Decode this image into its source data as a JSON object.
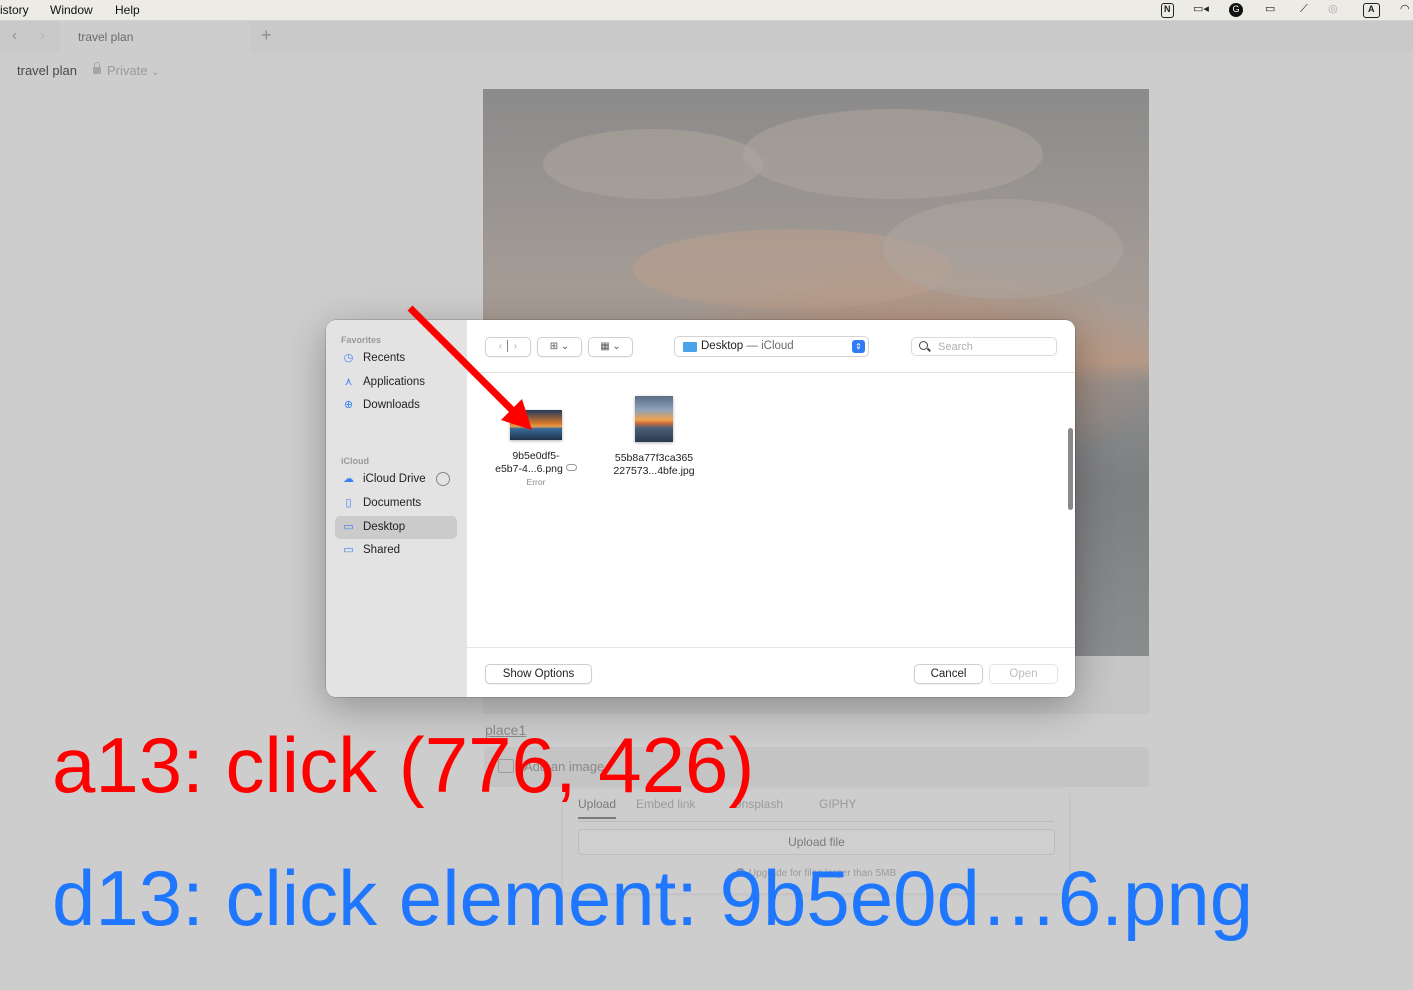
{
  "menubar": {
    "items": [
      "istory",
      "Window",
      "Help"
    ],
    "tray_icons": [
      "notion-icon",
      "zoom-icon",
      "grammarly-icon",
      "display-icon",
      "mic-mute-icon",
      "airdrop-icon",
      "input-source-icon",
      "wifi-icon"
    ],
    "tray_labels": {
      "notion": "N",
      "input_source": "A"
    }
  },
  "browser": {
    "tab_title": "travel plan",
    "new_tab": "+",
    "back": "‹",
    "forward": "›"
  },
  "page": {
    "breadcrumb_title": "travel plan",
    "privacy": "Private",
    "privacy_chevron": "⌄",
    "caption": "place1",
    "add_image_label": "Add an image",
    "upload_tabs": [
      "Upload",
      "Embed link",
      "Unsplash",
      "GIPHY"
    ],
    "upload_button": "Upload file",
    "upload_note": "Upgrade for files larger than 5MB"
  },
  "dialog": {
    "sidebar": {
      "favorites_header": "Favorites",
      "favorites": [
        {
          "label": "Recents",
          "icon": "clock-icon"
        },
        {
          "label": "Applications",
          "icon": "applications-icon"
        },
        {
          "label": "Downloads",
          "icon": "download-icon"
        }
      ],
      "icloud_header": "iCloud",
      "icloud": [
        {
          "label": "iCloud Drive",
          "icon": "cloud-icon"
        },
        {
          "label": "Documents",
          "icon": "document-icon"
        },
        {
          "label": "Desktop",
          "icon": "desktop-icon",
          "selected": true
        },
        {
          "label": "Shared",
          "icon": "shared-folder-icon"
        }
      ]
    },
    "toolbar": {
      "location": "Desktop",
      "location_sub": "— iCloud",
      "search_placeholder": "Search",
      "view_icon_glyph": "⊞",
      "group_icon_glyph": "▦",
      "chevron": "⌄"
    },
    "files": [
      {
        "name_line1": "9b5e0df5-",
        "name_line2": "e5b7-4...6.png",
        "status": "Error"
      },
      {
        "name_line1": "55b8a77f3ca365",
        "name_line2": "227573...4bfe.jpg",
        "status": ""
      }
    ],
    "buttons": {
      "show_options": "Show Options",
      "cancel": "Cancel",
      "open": "Open"
    }
  },
  "annotations": {
    "action": "a13: click (776, 426)",
    "description": "d13: click element: 9b5e0d…6.png",
    "action_color": "#ff0000",
    "description_color": "#1f77ff"
  }
}
